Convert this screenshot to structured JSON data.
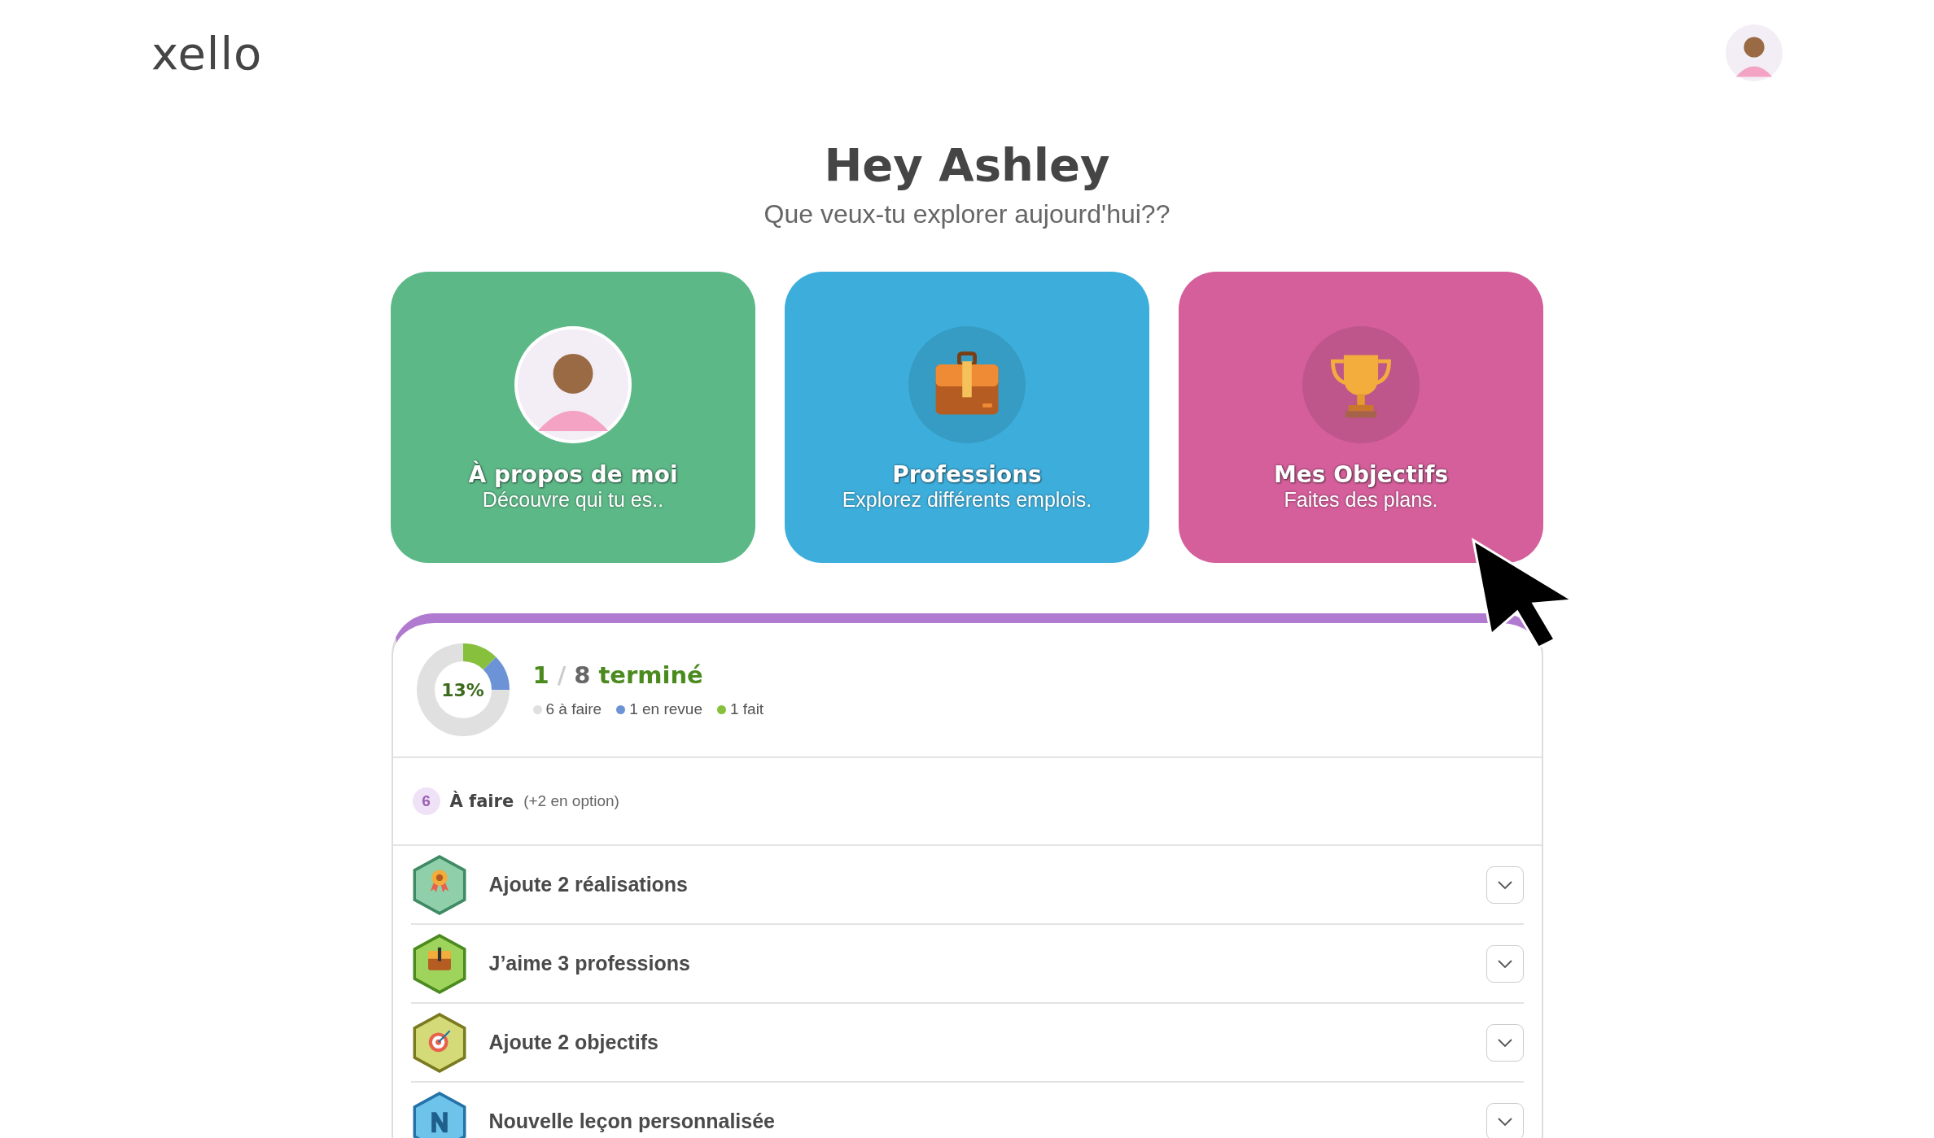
{
  "header": {
    "logo": "xello"
  },
  "greeting": {
    "title": "Hey Ashley",
    "subtitle": "Que veux-tu explorer aujourd'hui??"
  },
  "cards": [
    {
      "kind": "avatar",
      "title": "À propos de moi",
      "subtitle": "Découvre qui tu es..",
      "color": "#5db887"
    },
    {
      "kind": "briefcase",
      "title": "Professions",
      "subtitle": "Explorez différents emplois.",
      "color": "#3daedb"
    },
    {
      "kind": "trophy",
      "title": "Mes Objectifs",
      "subtitle": "Faites des plans.",
      "color": "#d45f9b"
    }
  ],
  "progress": {
    "percent": "13%",
    "done": "1",
    "separator": "/",
    "total": "8",
    "label": "terminé",
    "legend": [
      {
        "text": "6 à faire",
        "color": "#e0e0e0"
      },
      {
        "text": "1 en revue",
        "color": "#6b93d6"
      },
      {
        "text": "1 fait",
        "color": "#86c03c"
      }
    ],
    "chart_data": {
      "type": "donut",
      "values": [
        75,
        12.5,
        12.5
      ]
    }
  },
  "todo": {
    "count": "6",
    "title": "À faire",
    "note": "(+2 en option)"
  },
  "tasks": [
    {
      "kind": "medal",
      "label": "Ajoute 2 réalisations",
      "expanded": false
    },
    {
      "kind": "briefcase",
      "label": "J’aime 3 professions",
      "expanded": false
    },
    {
      "kind": "target",
      "label": "Ajoute 2 objectifs",
      "expanded": false
    },
    {
      "kind": "letter",
      "label": "Nouvelle leçon personnalisée",
      "expanded": false
    }
  ]
}
